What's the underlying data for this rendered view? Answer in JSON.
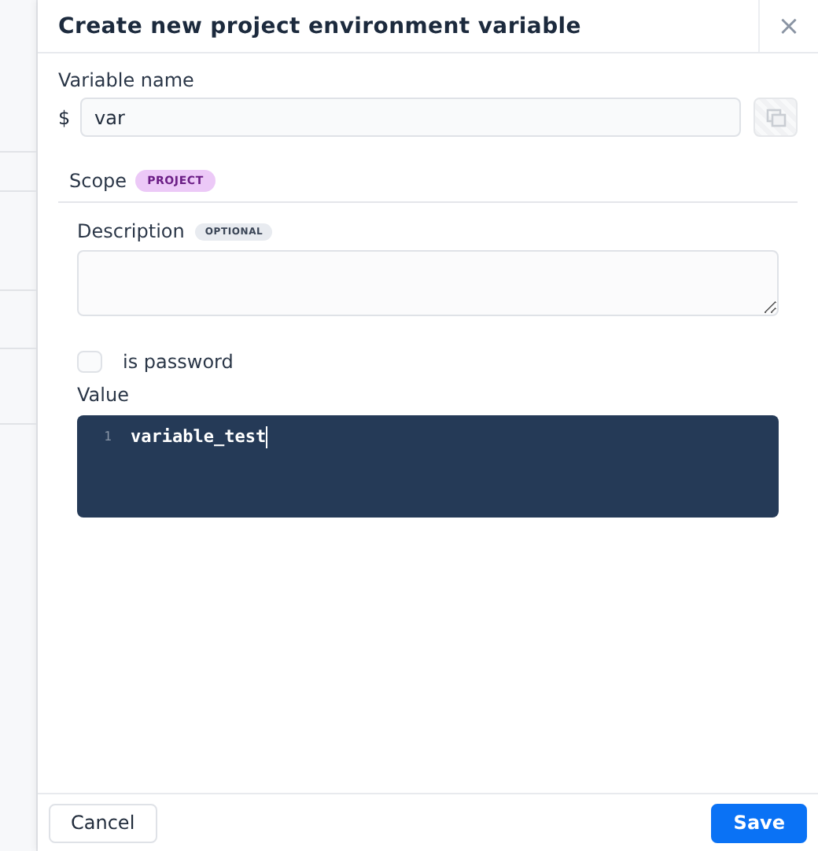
{
  "dialog": {
    "title": "Create new project environment variable",
    "close": "×"
  },
  "variable_name": {
    "label": "Variable name",
    "prefix": "$",
    "value": "var",
    "copy_disabled": true
  },
  "scope": {
    "label": "Scope",
    "badge": "PROJECT"
  },
  "description": {
    "label": "Description",
    "badge": "OPTIONAL"
  },
  "is_password": {
    "label": "is password",
    "checked": false
  },
  "value": {
    "label": "Value",
    "lines": [
      {
        "number": "1",
        "text": "variable_test"
      }
    ]
  },
  "buttons": [
    {
      "label": "Cancel",
      "kind": "secondary"
    },
    {
      "label": "Save",
      "kind": "primary"
    }
  ]
}
